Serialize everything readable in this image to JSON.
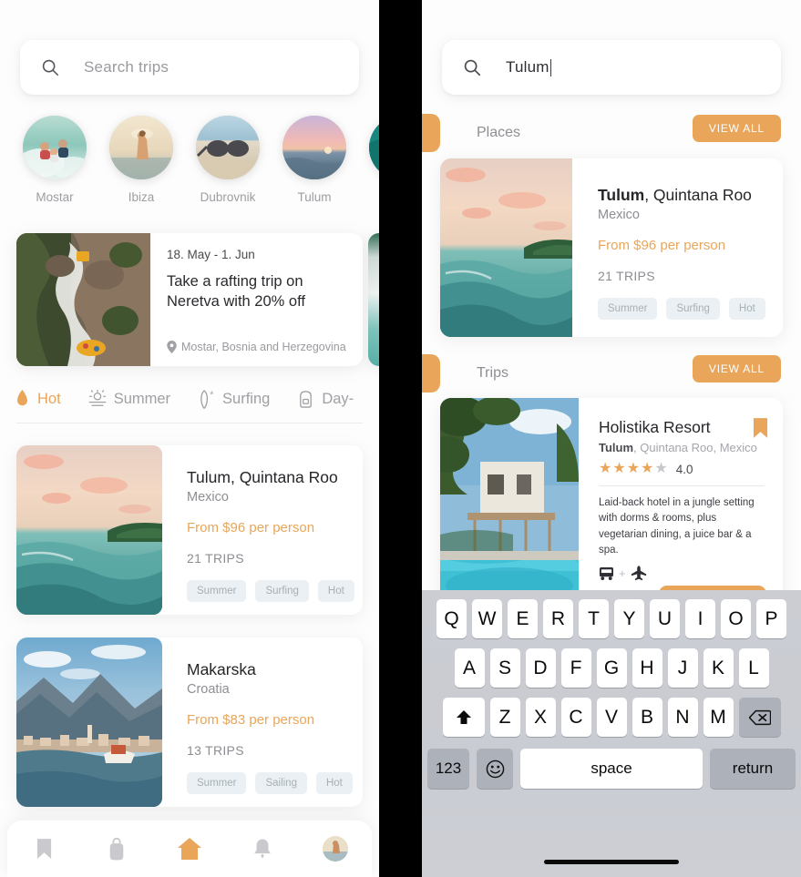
{
  "theme": {
    "accent": "#E9A65A",
    "chip_bg": "#EAF0F3",
    "chip_text": "#A7B0B6",
    "muted": "#8E8E94"
  },
  "left_phone": {
    "search": {
      "placeholder": "Search trips",
      "value": "",
      "icon": "search-icon"
    },
    "stories": [
      {
        "label": "Mostar"
      },
      {
        "label": "Ibiza"
      },
      {
        "label": "Dubrovnik"
      },
      {
        "label": "Tulum"
      },
      {
        "label": ""
      }
    ],
    "promo": {
      "date": "18. May - 1. Jun",
      "title": "Take a rafting trip on Neretva with 20% off",
      "location": "Mostar, Bosnia and Herzegovina",
      "location_icon": "map-pin-icon"
    },
    "tabs": [
      {
        "label": "Hot",
        "icon": "flame-icon",
        "active": true
      },
      {
        "label": "Summer",
        "icon": "sun-sea-icon",
        "active": false
      },
      {
        "label": "Surfing",
        "icon": "surfboard-icon",
        "active": false
      },
      {
        "label": "Day-",
        "icon": "backpack-icon",
        "active": false
      }
    ],
    "trips": [
      {
        "title": "Tulum, Quintana Roo",
        "subtitle": "Mexico",
        "price": "From $96 per person",
        "trips_count": "21 TRIPS",
        "chips": [
          "Summer",
          "Surfing",
          "Hot"
        ]
      },
      {
        "title": "Makarska",
        "subtitle": "Croatia",
        "price": "From $83 per person",
        "trips_count": "13 TRIPS",
        "chips": [
          "Summer",
          "Sailing",
          "Hot"
        ]
      }
    ],
    "bottom_nav": [
      {
        "icon": "bookmark-icon",
        "active": false
      },
      {
        "icon": "bag-icon",
        "active": false
      },
      {
        "icon": "home-icon",
        "active": true
      },
      {
        "icon": "bell-icon",
        "active": false
      },
      {
        "icon": "avatar-icon",
        "active": false
      }
    ]
  },
  "right_phone": {
    "search": {
      "placeholder": "Search trips",
      "value": "Tulum",
      "icon": "search-icon"
    },
    "sections": [
      {
        "title": "Places",
        "view_all": "VIEW ALL"
      },
      {
        "title": "Trips",
        "view_all": "VIEW ALL"
      }
    ],
    "place_result": {
      "title_match": "Tulum",
      "title_rest": ", Quintana Roo",
      "subtitle": "Mexico",
      "price": "From $96 per person",
      "trips_count": "21 TRIPS",
      "chips": [
        "Summer",
        "Surfing",
        "Hot"
      ]
    },
    "trip_result": {
      "title": "Holistika Resort",
      "sub_match": "Tulum",
      "sub_rest": ", Quintana Roo, Mexico",
      "rating_value": "4.0",
      "stars_filled": 4,
      "stars_total": 5,
      "description": "Laid-back hotel in a jungle setting with dorms & rooms, plus vegetarian dining, a juice bar & a spa.",
      "transport_icons": [
        "bus-icon",
        "plus-sign",
        "plane-icon"
      ],
      "bookmark_icon": "bookmark-flag-icon"
    },
    "keyboard": {
      "row1": [
        "Q",
        "W",
        "E",
        "R",
        "T",
        "Y",
        "U",
        "I",
        "O",
        "P"
      ],
      "row2": [
        "A",
        "S",
        "D",
        "F",
        "G",
        "H",
        "J",
        "K",
        "L"
      ],
      "row3": [
        "Z",
        "X",
        "C",
        "V",
        "B",
        "N",
        "M"
      ],
      "shift_icon": "shift-up-icon",
      "backspace_icon": "backspace-icon",
      "numeric_label": "123",
      "emoji_icon": "emoji-smiley-icon",
      "space_label": "space",
      "return_label": "return"
    }
  }
}
